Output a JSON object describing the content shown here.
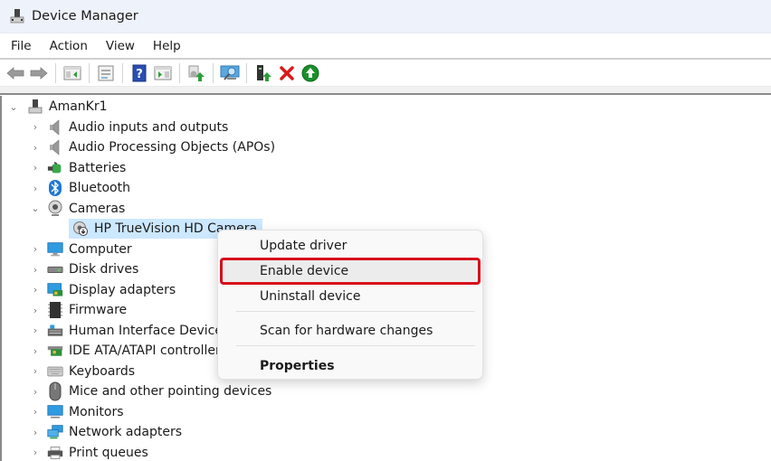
{
  "window": {
    "title": "Device Manager",
    "icon": "device-manager-icon"
  },
  "menubar": {
    "items": [
      "File",
      "Action",
      "View",
      "Help"
    ]
  },
  "toolbar": {
    "buttons": [
      {
        "name": "back",
        "icon": "back-arrow-icon"
      },
      {
        "name": "forward",
        "icon": "forward-arrow-icon"
      },
      {
        "name": "show-hide-console-tree",
        "icon": "console-tree-icon"
      },
      {
        "name": "properties",
        "icon": "properties-sheet-icon"
      },
      {
        "name": "help",
        "icon": "help-icon"
      },
      {
        "name": "show-hide-action-pane",
        "icon": "action-pane-icon"
      },
      {
        "name": "update-driver",
        "icon": "update-driver-icon"
      },
      {
        "name": "scan-hardware-changes",
        "icon": "scan-hardware-icon"
      },
      {
        "name": "add-legacy-hardware",
        "icon": "add-hardware-icon"
      },
      {
        "name": "uninstall-device",
        "icon": "uninstall-x-icon"
      },
      {
        "name": "enable-device",
        "icon": "enable-device-icon"
      }
    ]
  },
  "tree": {
    "root": {
      "label": "AmanKr1",
      "expanded": true
    },
    "categories": [
      {
        "label": "Audio inputs and outputs",
        "icon": "speaker-icon",
        "expanded": false
      },
      {
        "label": "Audio Processing Objects (APOs)",
        "icon": "speaker-icon",
        "expanded": false
      },
      {
        "label": "Batteries",
        "icon": "battery-icon",
        "expanded": false
      },
      {
        "label": "Bluetooth",
        "icon": "bluetooth-icon",
        "expanded": false
      },
      {
        "label": "Cameras",
        "icon": "webcam-icon",
        "expanded": true,
        "children": [
          {
            "label": "HP TrueVision HD Camera",
            "icon": "disabled-camera-icon",
            "selected": true
          }
        ]
      },
      {
        "label": "Computer",
        "icon": "computer-icon",
        "expanded": false
      },
      {
        "label": "Disk drives",
        "icon": "disk-drive-icon",
        "expanded": false
      },
      {
        "label": "Display adapters",
        "icon": "display-adapter-icon",
        "expanded": false
      },
      {
        "label": "Firmware",
        "icon": "firmware-chip-icon",
        "expanded": false
      },
      {
        "label": "Human Interface Devices",
        "icon": "hid-icon",
        "expanded": false
      },
      {
        "label": "IDE ATA/ATAPI controllers",
        "icon": "ide-controller-icon",
        "expanded": false
      },
      {
        "label": "Keyboards",
        "icon": "keyboard-icon",
        "expanded": false
      },
      {
        "label": "Mice and other pointing devices",
        "icon": "mouse-icon",
        "expanded": false
      },
      {
        "label": "Monitors",
        "icon": "monitor-icon",
        "expanded": false
      },
      {
        "label": "Network adapters",
        "icon": "network-icon",
        "expanded": false
      },
      {
        "label": "Print queues",
        "icon": "printer-icon",
        "expanded": false
      }
    ]
  },
  "context_menu": {
    "items": [
      {
        "label": "Update driver"
      },
      {
        "label": "Enable device",
        "highlighted": true
      },
      {
        "label": "Uninstall device"
      },
      {
        "label": "Scan for hardware changes"
      },
      {
        "label": "Properties",
        "bold": true
      }
    ],
    "highlight_color": "#d7101c"
  },
  "colors": {
    "titlebar_bg": "#eef2fa",
    "selection_bg": "#cce8ff",
    "menu_bg": "#f9f9f9"
  }
}
